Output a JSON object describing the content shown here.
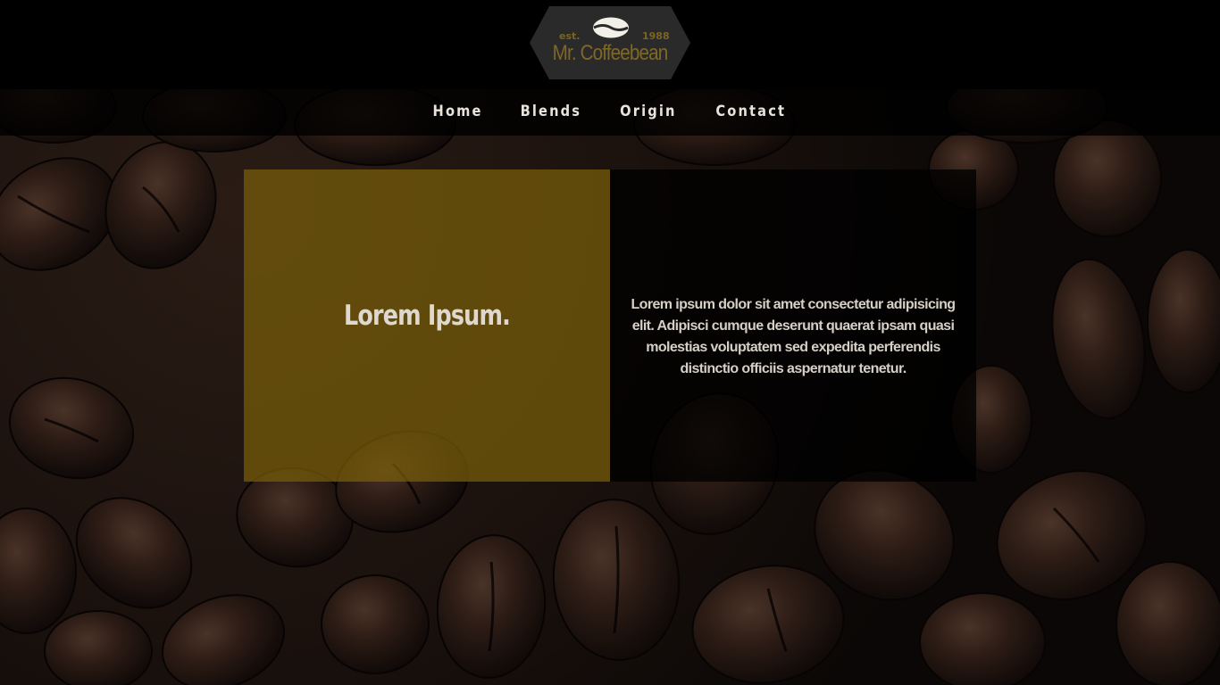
{
  "logo": {
    "est": "est.",
    "year": "1988",
    "name": "Mr. Coffeebean",
    "bean_icon": "coffee-bean-icon"
  },
  "nav": {
    "items": [
      {
        "label": "Home"
      },
      {
        "label": "Blends"
      },
      {
        "label": "Origin"
      },
      {
        "label": "Contact"
      }
    ]
  },
  "hero": {
    "title": "Lorem Ipsum.",
    "text": "Lorem ipsum dolor sit amet consectetur adipisicing elit. Adipisci cumque deserunt quaerat ipsam quasi molestias voluptatem sed expedita perferendis distinctio officiis aspernatur tenetur."
  },
  "colors": {
    "accent": "#806724",
    "gold_panel": "#785e0a",
    "background": "#000000",
    "nav_text": "#e8e3db"
  }
}
